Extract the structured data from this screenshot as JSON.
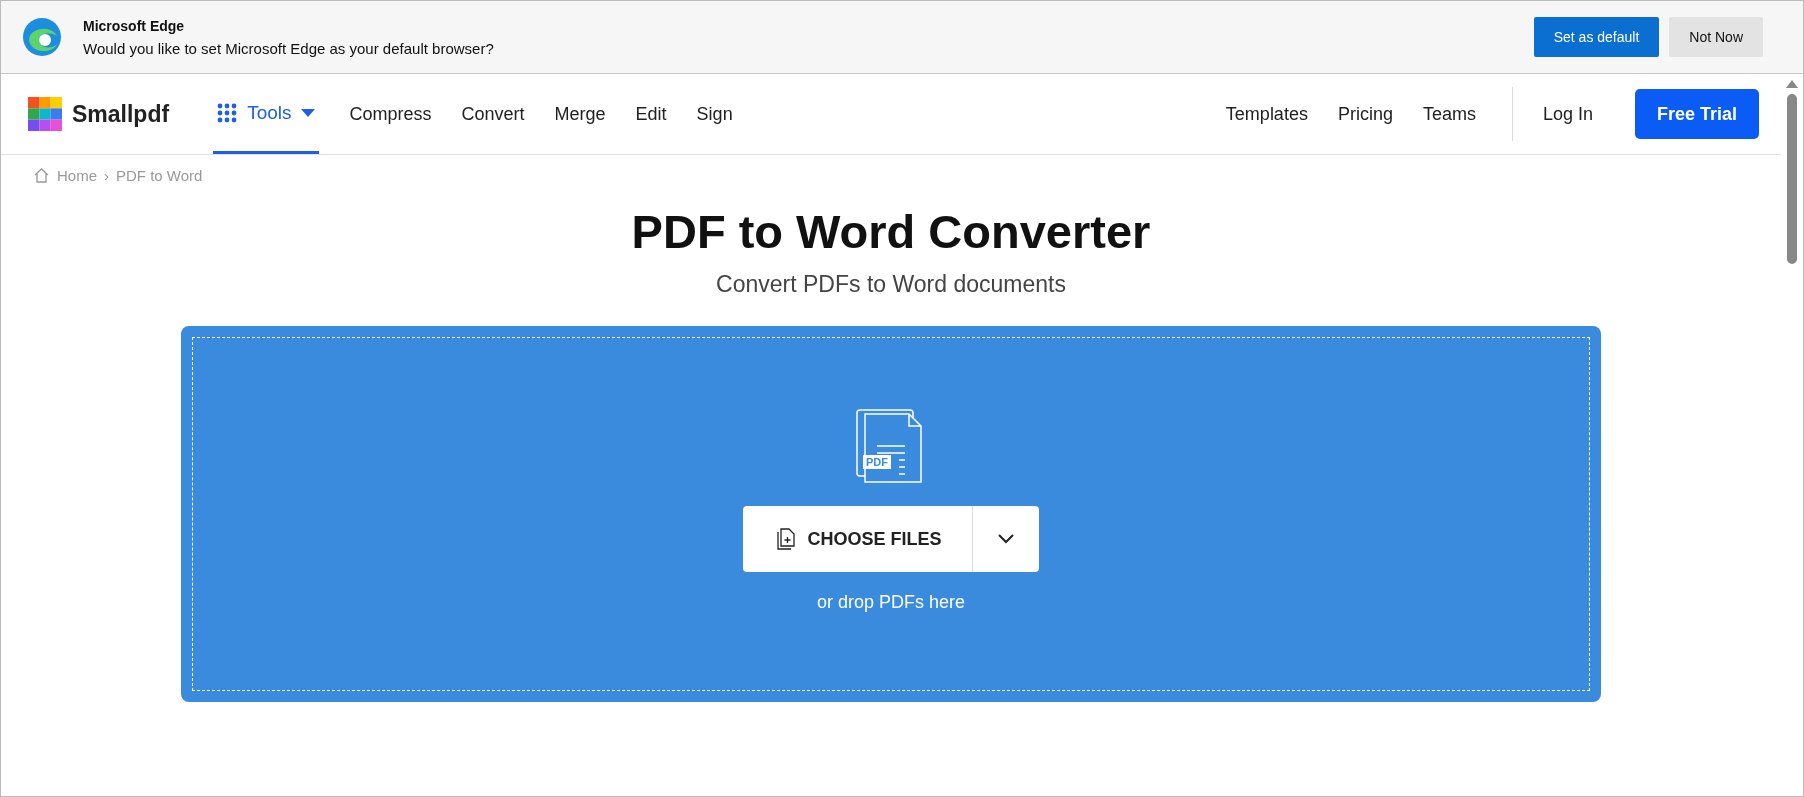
{
  "banner": {
    "title": "Microsoft Edge",
    "message": "Would you like to set Microsoft Edge as your default browser?",
    "buttons": [
      {
        "label": "Set as default",
        "kind": "primary"
      },
      {
        "label": "Not Now",
        "kind": "secondary"
      }
    ]
  },
  "nav": {
    "brand": "Smallpdf",
    "tools": {
      "label": "Tools",
      "selected": true
    },
    "links": [
      "Compress",
      "Convert",
      "Merge",
      "Edit",
      "Sign"
    ],
    "right_links": [
      "Templates",
      "Pricing",
      "Teams"
    ],
    "login": "Log In",
    "cta": "Free Trial"
  },
  "breadcrumb": {
    "items": [
      "Home",
      "PDF to Word"
    ],
    "separator": "›"
  },
  "heading": "PDF to Word Converter",
  "subheading": "Convert PDFs to Word documents",
  "dropzone": {
    "icon_label": "PDF",
    "button": "CHOOSE FILES",
    "hint": "or drop PDFs here"
  }
}
